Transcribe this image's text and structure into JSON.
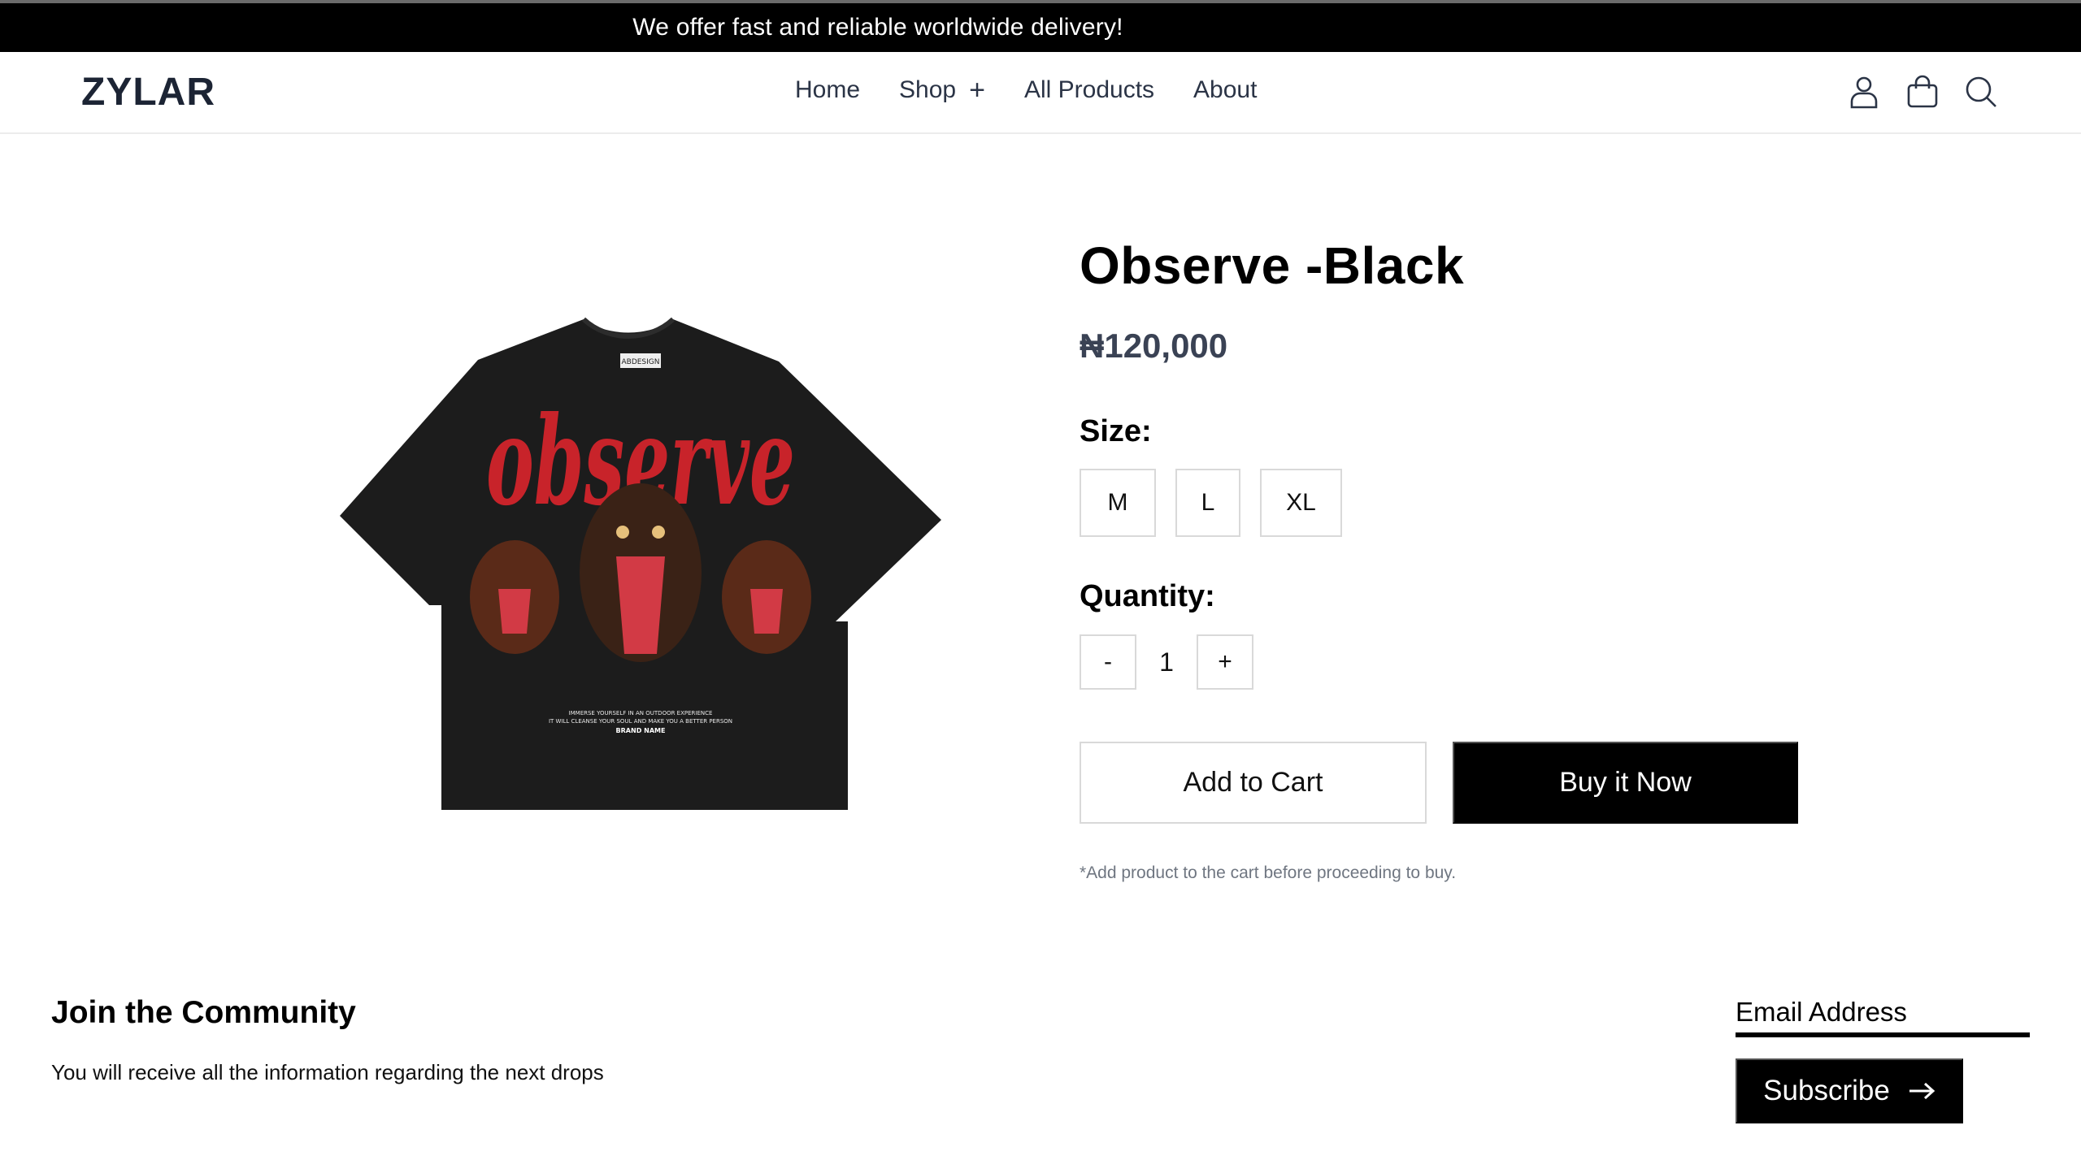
{
  "announcement": "We offer fast and reliable worldwide delivery!",
  "brand": "ZYLAR",
  "nav": {
    "items": [
      {
        "label": "Home"
      },
      {
        "label": "Shop",
        "has_plus": true
      },
      {
        "label": "All Products"
      },
      {
        "label": "About"
      }
    ],
    "plus_glyph": "+"
  },
  "header_icons": [
    "user-icon",
    "bag-icon",
    "search-icon"
  ],
  "product": {
    "title": "Observe -Black",
    "price": "₦120,000",
    "size_label": "Size:",
    "sizes": [
      "M",
      "L",
      "XL"
    ],
    "quantity_label": "Quantity:",
    "quantity": "1",
    "decrement": "-",
    "increment": "+",
    "add_to_cart": "Add to Cart",
    "buy_now": "Buy it Now",
    "note": "*Add product to the cart before proceeding to buy.",
    "image": {
      "shirt_text": "observe",
      "tag": "ABDESIGN",
      "small_lines": [
        "IMMERSE YOURSELF IN AN OUTDOOR EXPERIENCE",
        "IT WILL CLEANSE YOUR SOUL AND MAKE YOU A BETTER PERSON",
        "BRAND NAME"
      ],
      "shirt_color": "#1c1c1c",
      "print_color": "#c8232a"
    }
  },
  "community": {
    "title": "Join the Community",
    "text": "You will receive all the information regarding the next drops"
  },
  "newsletter": {
    "email_placeholder": "Email Address",
    "subscribe": "Subscribe"
  }
}
